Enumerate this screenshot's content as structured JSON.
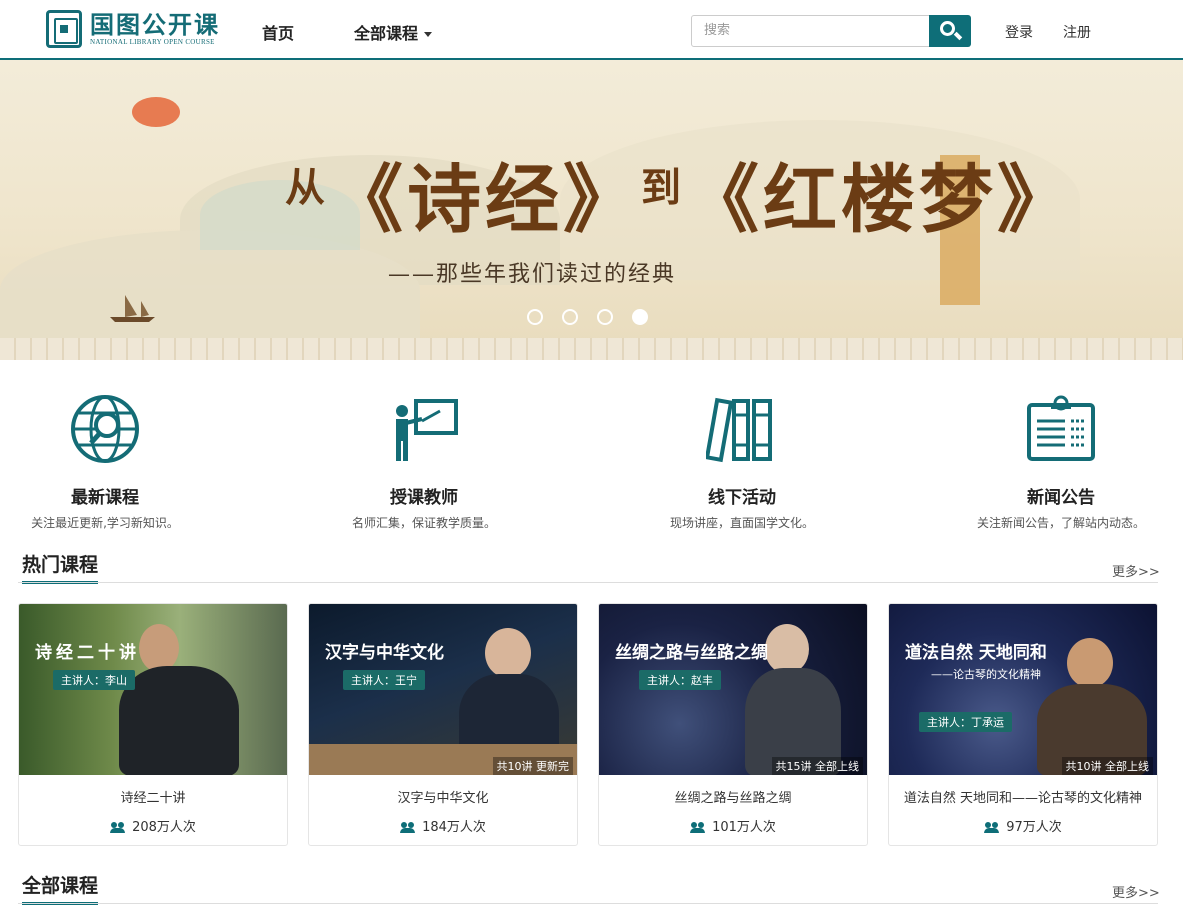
{
  "header": {
    "logo_cn": "国图公开课",
    "logo_en": "NATIONAL LIBRARY OPEN COURSE",
    "nav_home": "首页",
    "nav_all": "全部课程",
    "search_placeholder": "搜索",
    "login": "登录",
    "register": "注册"
  },
  "banner": {
    "title_pre": "从",
    "title_main_1": "《诗经》",
    "title_mid": "到",
    "title_main_2": "《红楼梦》",
    "subtitle": "——那些年我们读过的经典",
    "slides_count": 4,
    "active_slide": 4
  },
  "features": [
    {
      "title": "最新课程",
      "desc": "关注最近更新,学习新知识。",
      "icon": "globe-search-icon"
    },
    {
      "title": "授课教师",
      "desc": "名师汇集，保证教学质量。",
      "icon": "teacher-icon"
    },
    {
      "title": "线下活动",
      "desc": "现场讲座，直面国学文化。",
      "icon": "books-icon"
    },
    {
      "title": "新闻公告",
      "desc": "关注新闻公告，了解站内动态。",
      "icon": "clipboard-icon"
    }
  ],
  "hot": {
    "title": "热门课程",
    "more": "更多>>",
    "courses": [
      {
        "thumb_title": "诗经二十讲",
        "lecturer": "主讲人：李山",
        "episodes": "",
        "name": "诗经二十讲",
        "views": "208万人次"
      },
      {
        "thumb_title": "汉字与中华文化",
        "lecturer": "主讲人：王宁",
        "episodes": "共10讲  更新完",
        "name": "汉字与中华文化",
        "views": "184万人次"
      },
      {
        "thumb_title": "丝绸之路与丝路之绸",
        "lecturer": "主讲人：赵丰",
        "episodes": "共15讲  全部上线",
        "name": "丝绸之路与丝路之绸",
        "views": "101万人次"
      },
      {
        "thumb_title": "道法自然  天地同和",
        "thumb_sub": "——论古琴的文化精神",
        "lecturer": "主讲人：丁承运",
        "episodes": "共10讲  全部上线",
        "name": "道法自然 天地同和——论古琴的文化精神",
        "views": "97万人次"
      }
    ]
  },
  "all": {
    "title": "全部课程",
    "more": "更多>>"
  }
}
